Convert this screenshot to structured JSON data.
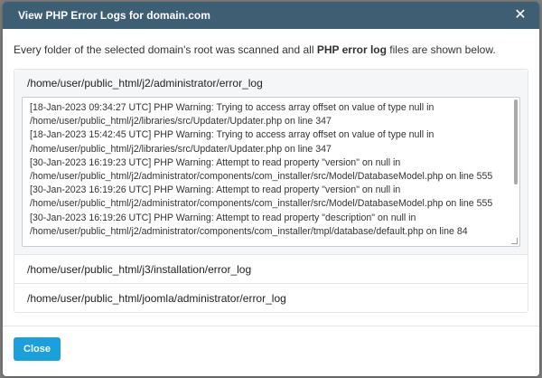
{
  "dialog": {
    "title": "View PHP Error Logs for domain.com",
    "close_icon": "close-icon",
    "intro_before": "Every folder of the selected domain's root was scanned and all ",
    "intro_bold": "PHP error log",
    "intro_after": " files are shown below."
  },
  "logs": [
    {
      "path": "/home/user/public_html/j2/administrator/error_log",
      "expanded": true,
      "lines": [
        "[18-Jan-2023 09:34:27 UTC] PHP Warning:  Trying to access array offset on value of type null in",
        "/home/user/public_html/j2/libraries/src/Updater/Updater.php on line 347",
        "[18-Jan-2023 15:42:45 UTC] PHP Warning:  Trying to access array offset on value of type null in",
        "/home/user/public_html/j2/libraries/src/Updater/Updater.php on line 347",
        "[30-Jan-2023 16:19:23 UTC] PHP Warning:  Attempt to read property \"version\" on null in",
        "/home/user/public_html/j2/administrator/components/com_installer/src/Model/DatabaseModel.php on line 555",
        "[30-Jan-2023 16:19:26 UTC] PHP Warning:  Attempt to read property \"version\" on null in",
        "/home/user/public_html/j2/administrator/components/com_installer/src/Model/DatabaseModel.php on line 555",
        "[30-Jan-2023 16:19:26 UTC] PHP Warning:  Attempt to read property \"description\" on null in",
        "/home/user/public_html/j2/administrator/components/com_installer/tmpl/database/default.php on line 84"
      ]
    },
    {
      "path": "/home/user/public_html/j3/installation/error_log",
      "expanded": false
    },
    {
      "path": "/home/user/public_html/joomla/administrator/error_log",
      "expanded": false
    }
  ],
  "footer": {
    "close_label": "Close"
  }
}
